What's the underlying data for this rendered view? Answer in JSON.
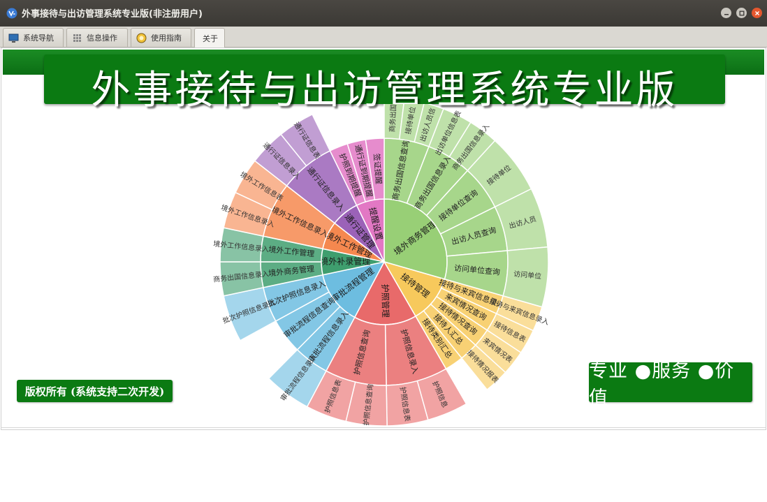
{
  "window": {
    "title": "外事接待与出访管理系统专业版(非注册用户)",
    "accent_color": "#0b7a12"
  },
  "tabs": [
    {
      "label": "系统导航",
      "icon": "monitor-icon"
    },
    {
      "label": "信息操作",
      "icon": "grid-icon"
    },
    {
      "label": "使用指南",
      "icon": "help-icon"
    },
    {
      "label": "关于",
      "icon": ""
    }
  ],
  "banner": {
    "title": "外事接待与出访管理系统专业版"
  },
  "copyright": "版权所有 (系统支持二次开发)",
  "slogan": "专业 ●服务 ●价值",
  "menu_wheel": [
    {
      "label": "境外商务管理",
      "color": "#98cf76",
      "children": [
        {
          "label": "商务出国信息查询",
          "leaves": [
            "商务出国",
            "接待单位",
            "出访人员信"
          ]
        },
        {
          "label": "商务出国信息录入",
          "leaves": [
            "出访单位信息表",
            "商务出国信息录入"
          ]
        },
        {
          "label": "接待单位查询",
          "leaves": [
            "接待单位"
          ]
        },
        {
          "label": "出访人员查询",
          "leaves": [
            "出访人员"
          ]
        },
        {
          "label": "访问单位查询",
          "leaves": [
            "访问单位"
          ]
        }
      ]
    },
    {
      "label": "接待管理",
      "color": "#f7c95c",
      "children": [
        {
          "label": "接待与来宾信息录入",
          "leaves": [
            "接待与来宾信息录入"
          ]
        },
        {
          "label": "来宾情况查询",
          "leaves": [
            "接待信息表"
          ]
        },
        {
          "label": "接待情况查询",
          "leaves": [
            "来宾情况表"
          ]
        },
        {
          "label": "接待人汇总",
          "leaves": [
            "接待情况报表"
          ]
        },
        {
          "label": "接待类别汇总",
          "leaves": []
        }
      ]
    },
    {
      "label": "护照管理",
      "color": "#e86a6a",
      "children": [
        {
          "label": "护照信息录入",
          "leaves": [
            "护照信息",
            "护照信息表"
          ]
        },
        {
          "label": "护照信息查询",
          "leaves": [
            "护照信息查询",
            "护照信息表"
          ]
        }
      ]
    },
    {
      "label": "审批流程管理",
      "color": "#6dbde0",
      "children": [
        {
          "label": "审批流程信息录入",
          "leaves": [
            "审批流程信息录入"
          ]
        },
        {
          "label": "审批流程信息查询",
          "leaves": []
        },
        {
          "label": "批次护照信息录入",
          "leaves": [
            "批次护照信息录入"
          ]
        }
      ]
    },
    {
      "label": "境外补录管理",
      "color": "#3f9e6e",
      "children": [
        {
          "label": "境外商务管理",
          "leaves": [
            "商务出国信息录入"
          ]
        },
        {
          "label": "境外工作管理",
          "leaves": [
            "境外工作信息录入"
          ]
        }
      ]
    },
    {
      "label": "境外工作管理",
      "color": "#f5884f",
      "children": [
        {
          "label": "境外工作信息录入",
          "leaves": [
            "境外工作信息录入",
            "境外工作信息表"
          ]
        }
      ]
    },
    {
      "label": "通行证管理",
      "color": "#9b62b8",
      "children": [
        {
          "label": "通行证信息录入",
          "leaves": [
            "通行证信息录入",
            "通行证信息表"
          ]
        }
      ]
    },
    {
      "label": "提醒设置",
      "color": "#e278c4",
      "children": [
        {
          "label": "护照到期提醒",
          "leaves": []
        },
        {
          "label": "通行证到期提醒",
          "leaves": []
        },
        {
          "label": "签证提醒",
          "leaves": []
        }
      ]
    }
  ]
}
